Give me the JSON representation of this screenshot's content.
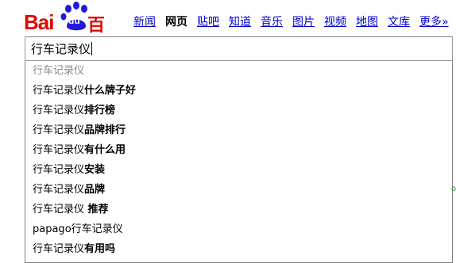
{
  "brand": {
    "bai": "Bai",
    "du": "du",
    "cn": "百度"
  },
  "nav": [
    {
      "label": "新闻",
      "active": false
    },
    {
      "label": "网页",
      "active": true
    },
    {
      "label": "贴吧",
      "active": false
    },
    {
      "label": "知道",
      "active": false
    },
    {
      "label": "音乐",
      "active": false
    },
    {
      "label": "图片",
      "active": false
    },
    {
      "label": "视频",
      "active": false
    },
    {
      "label": "地图",
      "active": false
    },
    {
      "label": "文库",
      "active": false
    },
    {
      "label": "更多»",
      "active": false
    }
  ],
  "search": {
    "value": "行车记录仪"
  },
  "suggestions": [
    {
      "prefix": "行车记录仪",
      "suffix": ""
    },
    {
      "prefix": "行车记录仪",
      "suffix": "什么牌子好"
    },
    {
      "prefix": "行车记录仪",
      "suffix": "排行榜"
    },
    {
      "prefix": "行车记录仪",
      "suffix": "品牌排行"
    },
    {
      "prefix": "行车记录仪",
      "suffix": "有什么用"
    },
    {
      "prefix": "行车记录仪",
      "suffix": "安装"
    },
    {
      "prefix": "行车记录仪",
      "suffix": "品牌"
    },
    {
      "prefix": "行车记录仪",
      "suffix": " 推荐"
    },
    {
      "prefix": "papago行车记录仪",
      "suffix": ""
    },
    {
      "prefix": "行车记录仪",
      "suffix": "有用吗"
    }
  ],
  "edge_mark": "o",
  "colors": {
    "brand_red": "#e10601",
    "brand_blue": "#2319dc",
    "link": "#0000cc"
  }
}
